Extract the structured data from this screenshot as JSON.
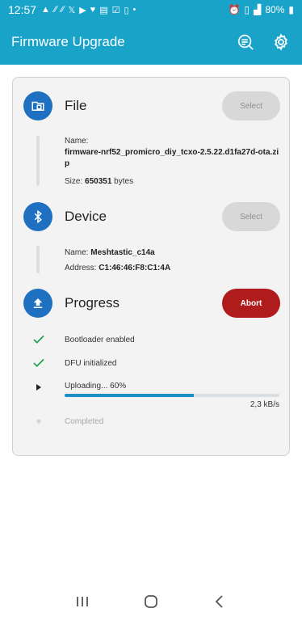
{
  "status_bar": {
    "time": "12:57",
    "notification_icons": [
      "alert-icon",
      "wave-icon",
      "wave-icon",
      "x-icon",
      "youtube-icon",
      "heart-icon",
      "doc-icon",
      "calendar-check-icon",
      "phone-icon",
      "dot-icon"
    ],
    "battery_percent": "80%"
  },
  "app_bar": {
    "title": "Firmware Upgrade",
    "color": "#1aa3c9"
  },
  "file_section": {
    "title": "File",
    "button": "Select",
    "name_label": "Name:",
    "name_value": "firmware-nrf52_promicro_diy_tcxo-2.5.22.d1fa27d-ota.zip",
    "size_label": "Size:",
    "size_value": "650351",
    "size_unit": "bytes"
  },
  "device_section": {
    "title": "Device",
    "button": "Select",
    "name_label": "Name:",
    "name_value": "Meshtastic_c14a",
    "address_label": "Address:",
    "address_value": "C1:46:46:F8:C1:4A"
  },
  "progress_section": {
    "title": "Progress",
    "button": "Abort",
    "abort_color": "#b01c1c",
    "steps": [
      {
        "label": "Bootloader enabled",
        "state": "done"
      },
      {
        "label": "DFU initialized",
        "state": "done"
      },
      {
        "label": "Uploading... 60%",
        "state": "active"
      },
      {
        "label": "Completed",
        "state": "pending"
      }
    ],
    "upload_progress": 0.6,
    "upload_speed": "2,3 kB/s"
  },
  "accent": "#1f70c1"
}
